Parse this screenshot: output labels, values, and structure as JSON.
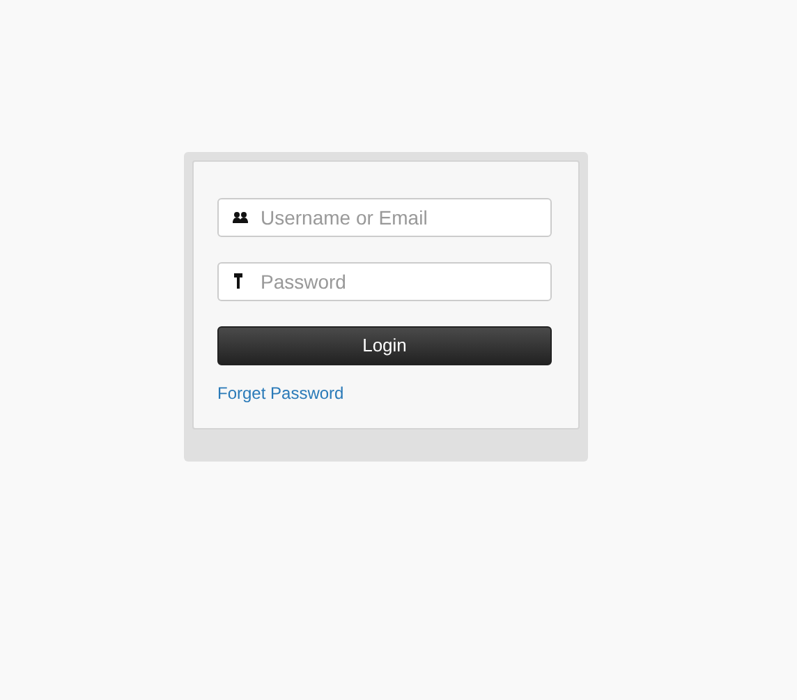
{
  "login_form": {
    "fields": [
      {
        "kind": "user",
        "placeholder": "Username or Email"
      },
      {
        "kind": "password",
        "placeholder": "Password"
      }
    ],
    "submit": "Login",
    "link": "Forget Password"
  }
}
